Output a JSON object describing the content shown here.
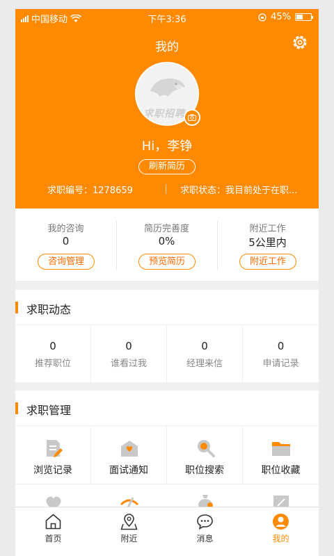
{
  "status_bar": {
    "carrier": "中国移动",
    "time": "下午3:36",
    "battery": "45%",
    "battery_level": 0.45
  },
  "header": {
    "title": "我的",
    "avatar_logo_text": "求职招聘",
    "greeting": "Hi，李铮",
    "refresh_label": "刷新简历",
    "job_id_label": "求职编号：",
    "job_id": "1278659",
    "job_status_label": "求职状态：",
    "job_status": "我目前处于在职..."
  },
  "stats": [
    {
      "label": "我的咨询",
      "value": "0",
      "button": "咨询管理"
    },
    {
      "label": "简历完善度",
      "value": "0%",
      "button": "预览简历"
    },
    {
      "label": "附近工作",
      "value": "5公里内",
      "button": "附近工作"
    }
  ],
  "dynamics": {
    "title": "求职动态",
    "items": [
      {
        "value": "0",
        "label": "推荐职位"
      },
      {
        "value": "0",
        "label": "谁看过我"
      },
      {
        "value": "0",
        "label": "经理来信"
      },
      {
        "value": "0",
        "label": "申请记录"
      }
    ]
  },
  "management": {
    "title": "求职管理",
    "items": [
      {
        "label": "浏览记录",
        "icon": "browse-history-icon"
      },
      {
        "label": "面试通知",
        "icon": "interview-notice-icon"
      },
      {
        "label": "职位搜索",
        "icon": "job-search-icon"
      },
      {
        "label": "职位收藏",
        "icon": "job-favorites-icon"
      }
    ]
  },
  "tabbar": [
    {
      "label": "首页",
      "icon": "home-icon"
    },
    {
      "label": "附近",
      "icon": "location-icon"
    },
    {
      "label": "消息",
      "icon": "message-icon"
    },
    {
      "label": "我的",
      "icon": "profile-icon",
      "active": true
    }
  ],
  "colors": {
    "accent": "#ff8a00",
    "button_text": "#ff6a00"
  }
}
